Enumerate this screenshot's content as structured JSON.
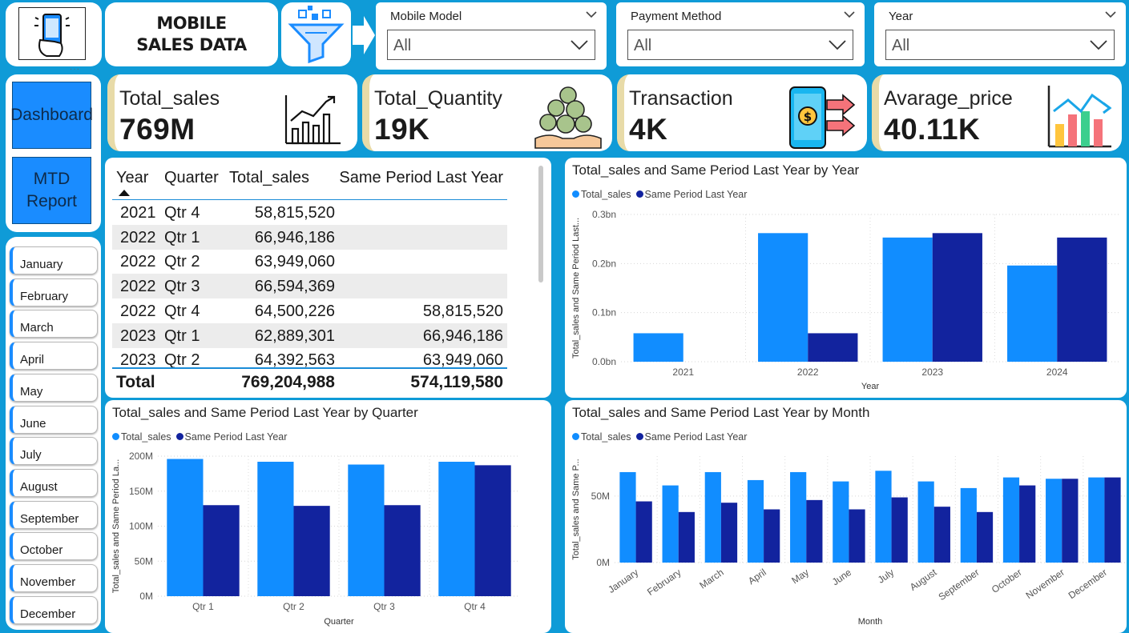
{
  "header": {
    "title": "MOBILE SALES DATA",
    "icons": [
      "phone-hand-icon",
      "funnel-icon",
      "arrow-right-icon"
    ]
  },
  "slicers": [
    {
      "label": "Mobile Model",
      "value": "All"
    },
    {
      "label": "Payment Method",
      "value": "All"
    },
    {
      "label": "Year",
      "value": "All"
    }
  ],
  "nav": {
    "dashboard": "Dashboard",
    "mtd_report": "MTD Report"
  },
  "months": [
    "January",
    "February",
    "March",
    "April",
    "May",
    "June",
    "July",
    "August",
    "September",
    "October",
    "November",
    "December"
  ],
  "kpis": [
    {
      "title": "Total_sales",
      "value": "769M",
      "icon": "growth-chart-icon"
    },
    {
      "title": "Total_Quantity",
      "value": "19K",
      "icon": "coins-hands-icon"
    },
    {
      "title": "Transaction",
      "value": "4K",
      "icon": "phone-transfer-icon"
    },
    {
      "title": "Avarage_price",
      "value": "40.11K",
      "icon": "bar-arrow-chart-icon"
    }
  ],
  "table": {
    "headers": [
      "Year",
      "Quarter",
      "Total_sales",
      "Same Period Last Year"
    ],
    "rows": [
      [
        "2021",
        "Qtr 4",
        "58,815,520",
        ""
      ],
      [
        "2022",
        "Qtr 1",
        "66,946,186",
        ""
      ],
      [
        "2022",
        "Qtr 2",
        "63,949,060",
        ""
      ],
      [
        "2022",
        "Qtr 3",
        "66,594,369",
        ""
      ],
      [
        "2022",
        "Qtr 4",
        "64,500,226",
        "58,815,520"
      ],
      [
        "2023",
        "Qtr 1",
        "62,889,301",
        "66,946,186"
      ],
      [
        "2023",
        "Qtr 2",
        "64,392,563",
        "63,949,060"
      ]
    ],
    "total": {
      "label": "Total",
      "sales": "769,204,988",
      "last": "574,119,580"
    }
  },
  "colors": {
    "total_sales": "#118dff",
    "same_period": "#12239e"
  },
  "chart_data": [
    {
      "type": "bar",
      "title": "Total_sales and Same Period Last Year by Year",
      "xlabel": "Year",
      "ylabel": "Total_sales and Same Period Last...",
      "categories": [
        "2021",
        "2022",
        "2023",
        "2024"
      ],
      "series": [
        {
          "name": "Total_sales",
          "values": [
            0.058,
            0.262,
            0.253,
            0.196
          ]
        },
        {
          "name": "Same Period Last Year",
          "values": [
            0,
            0.058,
            0.262,
            0.253
          ]
        }
      ],
      "yticks": [
        0,
        0.1,
        0.2,
        0.3
      ],
      "ytick_labels": [
        "0.0bn",
        "0.1bn",
        "0.2bn",
        "0.3bn"
      ],
      "ylim": [
        0,
        0.3
      ]
    },
    {
      "type": "bar",
      "title": "Total_sales and Same Period Last Year by Quarter",
      "xlabel": "Quarter",
      "ylabel": "Total_sales and Same Period La...",
      "categories": [
        "Qtr 1",
        "Qtr 2",
        "Qtr 3",
        "Qtr 4"
      ],
      "series": [
        {
          "name": "Total_sales",
          "values": [
            196,
            192,
            188,
            192
          ]
        },
        {
          "name": "Same Period Last Year",
          "values": [
            130,
            129,
            130,
            187
          ]
        }
      ],
      "yticks": [
        0,
        50,
        100,
        150,
        200
      ],
      "ytick_labels": [
        "0M",
        "50M",
        "100M",
        "150M",
        "200M"
      ],
      "ylim": [
        0,
        200
      ]
    },
    {
      "type": "bar",
      "title": "Total_sales and Same Period Last Year by Month",
      "xlabel": "Month",
      "ylabel": "Total_sales and Same P...",
      "categories": [
        "January",
        "February",
        "March",
        "April",
        "May",
        "June",
        "July",
        "August",
        "September",
        "October",
        "November",
        "December"
      ],
      "series": [
        {
          "name": "Total_sales",
          "values": [
            68,
            58,
            68,
            62,
            68,
            61,
            69,
            61,
            56,
            64,
            63,
            64
          ]
        },
        {
          "name": "Same Period Last Year",
          "values": [
            46,
            38,
            45,
            40,
            47,
            40,
            49,
            42,
            38,
            58,
            63,
            64
          ]
        }
      ],
      "yticks": [
        0,
        50
      ],
      "ytick_labels": [
        "0M",
        "50M"
      ],
      "ylim": [
        0,
        80
      ]
    }
  ]
}
